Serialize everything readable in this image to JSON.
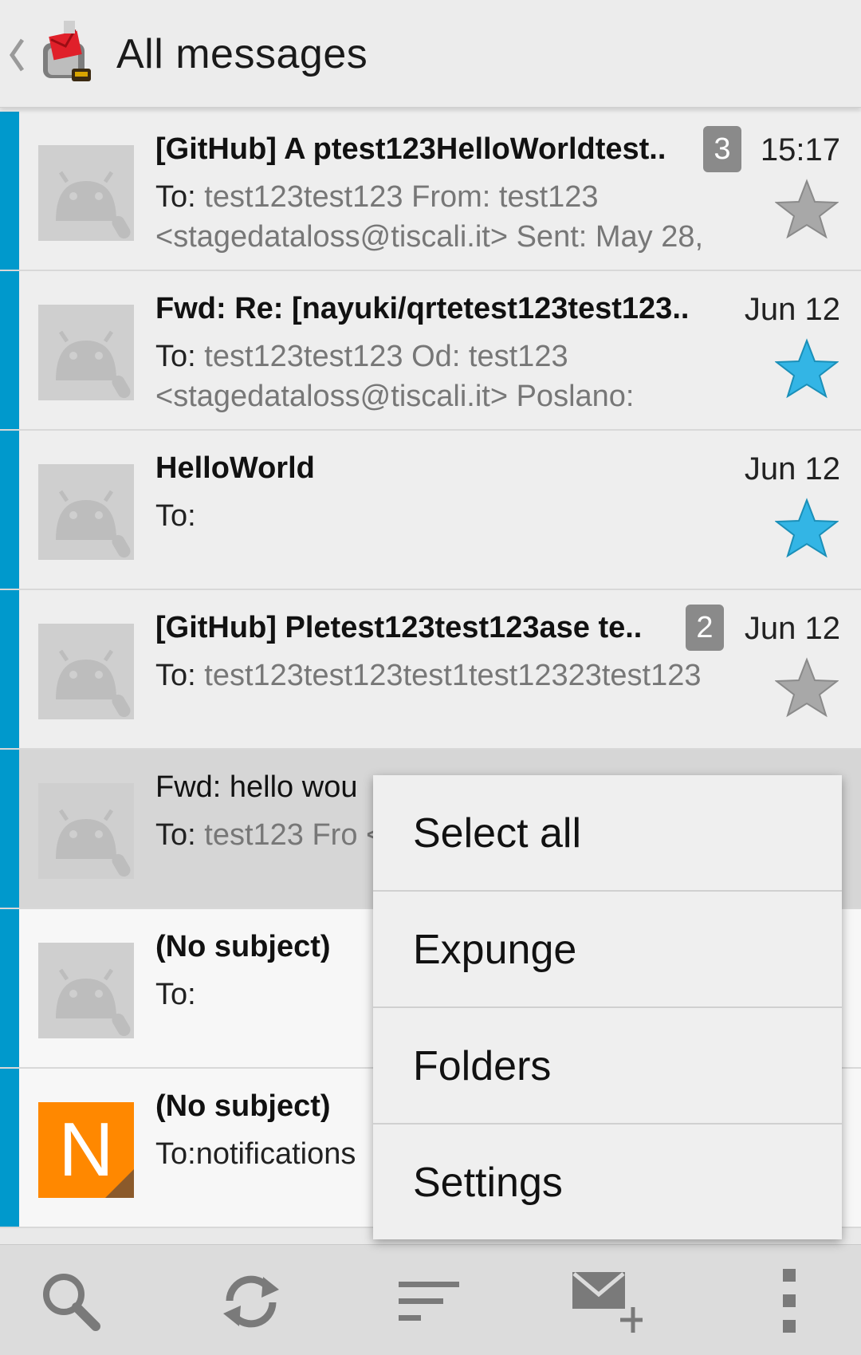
{
  "actionbar": {
    "title": "All messages"
  },
  "messages": [
    {
      "subject": "[GitHub] A ptest123HelloWorldtest..",
      "count": "3",
      "date": "15:17",
      "to_label": "To:",
      "preview": "test123test123 From: test123 <stagedataloss@tiscali.it> Sent: May 28,",
      "starred": false,
      "unread": true
    },
    {
      "subject": "Fwd: Re: [nayuki/qrtetest123test123..",
      "count": "",
      "date": "Jun 12",
      "to_label": "To:",
      "preview": "test123test123 Od: test123 <stagedataloss@tiscali.it> Poslano:",
      "starred": true,
      "unread": true
    },
    {
      "subject": "HelloWorld",
      "count": "",
      "date": "Jun 12",
      "to_label": "To:",
      "preview": "",
      "starred": true,
      "unread": true
    },
    {
      "subject": "[GitHub] Pletest123test123ase te..",
      "count": "2",
      "date": "Jun 12",
      "to_label": "To:",
      "preview": "test123test123test1test12323test123",
      "starred": false,
      "unread": true
    },
    {
      "subject": "Fwd: hello wou",
      "count": "",
      "date": "",
      "to_label": "To:",
      "preview": "test123 Fro <stagedataloss",
      "starred": false,
      "unread": true
    },
    {
      "subject": "(No subject)",
      "count": "",
      "date": "",
      "to_label": "To:",
      "preview": "",
      "starred": false,
      "unread": true
    },
    {
      "subject": "(No subject)",
      "count": "",
      "date": "",
      "to_label": "To:",
      "preview": "notifications",
      "starred": false,
      "unread": true,
      "avatar_letter": "N"
    }
  ],
  "menu": {
    "items": [
      "Select all",
      "Expunge",
      "Folders",
      "Settings"
    ]
  },
  "colors": {
    "accent": "#0099cc",
    "star_on": "#33b5e5",
    "star_off": "#a8a8a8",
    "avatar_orange": "#ff8800"
  },
  "toolbar_icons": [
    "search-icon",
    "refresh-icon",
    "sort-icon",
    "compose-icon",
    "overflow-icon"
  ]
}
